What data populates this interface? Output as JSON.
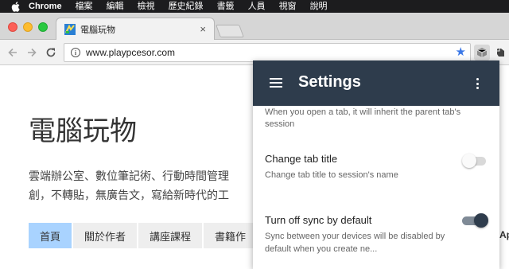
{
  "menubar": {
    "app": "Chrome",
    "items": [
      "檔案",
      "編輯",
      "檢視",
      "歷史紀錄",
      "書籤",
      "人員",
      "視窗",
      "說明"
    ]
  },
  "tab": {
    "title": "電腦玩物",
    "close": "×"
  },
  "toolbar": {
    "url": "www.playpcesor.com"
  },
  "page": {
    "title": "電腦玩物",
    "description": [
      "雲端辦公室、數位筆記術、行動時間管理",
      "創，不轉貼，無廣告文，寫給新時代的工"
    ],
    "nav": [
      "首頁",
      "關於作者",
      "講座課程",
      "書籍作"
    ],
    "nav_active_index": 0,
    "right_edge_text": "Ap"
  },
  "popup": {
    "title": "Settings",
    "partial_desc": "When you open a tab, it will inherit the parent tab's session",
    "options": [
      {
        "title": "Change tab title",
        "desc": "Change tab title to session's name",
        "enabled": false
      },
      {
        "title": "Turn off sync by default",
        "desc": "Sync between your devices will be disabled by default when you create ne...",
        "enabled": true
      }
    ]
  },
  "colors": {
    "popup_header": "#2e3c4c",
    "active_nav": "#a9d3ff",
    "bookmark_star": "#3b78e7"
  },
  "icons": [
    "apple-icon",
    "tab-favicon",
    "close-icon",
    "back-arrow-icon",
    "forward-arrow-icon",
    "reload-icon",
    "info-icon",
    "star-icon",
    "session-box-icon",
    "evernote-icon",
    "hamburger-icon",
    "more-vert-icon"
  ]
}
